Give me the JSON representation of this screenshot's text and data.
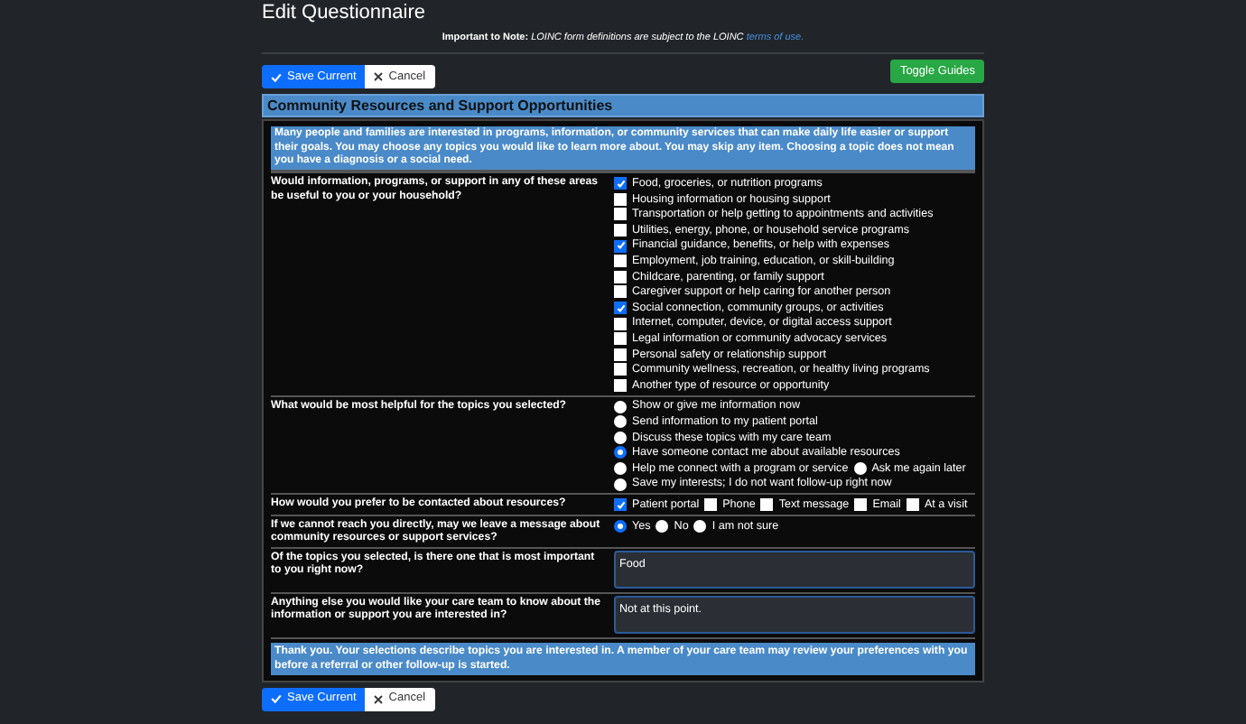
{
  "page_title": "Edit Questionnaire",
  "note": {
    "label": "Important to Note:",
    "text": "LOINC form definitions are subject to the LOINC",
    "link": "terms of use."
  },
  "top_buttons": [
    {
      "kind": "save",
      "label": "Save Current"
    },
    {
      "kind": "cancel",
      "label": "Cancel"
    }
  ],
  "toggle_button": "Toggle Guides",
  "section": {
    "title": "Community Resources and Support Opportunities",
    "intro": "Many people and families are interested in programs, information, or community services that can make daily life easier or support their goals. You may choose any topics you would like to learn more about. You may skip any item. Choosing a topic does not mean you have a diagnosis or a social need.",
    "questions": [
      {
        "kind": "checkbox",
        "question": "Would information, programs, or support in any of these areas be useful to you or your household?",
        "lines": [
          [
            {
              "label": "Food, groceries, or nutrition programs",
              "checked": true
            }
          ],
          [
            {
              "label": "Housing information or housing support",
              "checked": false
            }
          ],
          [
            {
              "label": "Transportation or help getting to appointments and activities",
              "checked": false
            }
          ],
          [
            {
              "label": "Utilities, energy, phone, or household service programs",
              "checked": false
            }
          ],
          [
            {
              "label": "Financial guidance, benefits, or help with expenses",
              "checked": true
            }
          ],
          [
            {
              "label": "Employment, job training, education, or skill-building",
              "checked": false
            }
          ],
          [
            {
              "label": "Childcare, parenting, or family support",
              "checked": false
            }
          ],
          [
            {
              "label": "Caregiver support or help caring for another person",
              "checked": false
            }
          ],
          [
            {
              "label": "Social connection, community groups, or activities",
              "checked": true
            }
          ],
          [
            {
              "label": "Internet, computer, device, or digital access support",
              "checked": false
            }
          ],
          [
            {
              "label": "Legal information or community advocacy services",
              "checked": false
            }
          ],
          [
            {
              "label": "Personal safety or relationship support",
              "checked": false
            }
          ],
          [
            {
              "label": "Community wellness, recreation, or healthy living programs",
              "checked": false
            }
          ],
          [
            {
              "label": "Another type of resource or opportunity",
              "checked": false
            }
          ]
        ]
      },
      {
        "kind": "radio",
        "question": "What would be most helpful for the topics you selected?",
        "lines": [
          [
            {
              "label": "Show or give me information now",
              "selected": false
            }
          ],
          [
            {
              "label": "Send information to my patient portal",
              "selected": false
            }
          ],
          [
            {
              "label": "Discuss these topics with my care team",
              "selected": false
            }
          ],
          [
            {
              "label": "Have someone contact me about available resources",
              "selected": true
            }
          ],
          [
            {
              "label": "Help me connect with a program or service",
              "selected": false
            },
            {
              "label": "Ask me again later",
              "selected": false
            }
          ],
          [
            {
              "label": "Save my interests; I do not want follow-up right now",
              "selected": false
            }
          ]
        ]
      },
      {
        "kind": "checkbox",
        "question": "How would you prefer to be contacted about resources?",
        "lines": [
          [
            {
              "label": "Patient portal",
              "checked": true
            },
            {
              "label": "Phone",
              "checked": false
            },
            {
              "label": "Text message",
              "checked": false
            },
            {
              "label": "Email",
              "checked": false
            },
            {
              "label": "At a visit",
              "checked": false
            }
          ]
        ]
      },
      {
        "kind": "radio",
        "question": "If we cannot reach you directly, may we leave a message about community resources or support services?",
        "lines": [
          [
            {
              "label": "Yes",
              "selected": true
            },
            {
              "label": "No",
              "selected": false
            },
            {
              "label": "I am not sure",
              "selected": false
            }
          ]
        ]
      },
      {
        "kind": "text",
        "question": "Of the topics you selected, is there one that is most important to you right now?",
        "value": "Food"
      },
      {
        "kind": "text",
        "question": "Anything else you would like your care team to know about the information or support you are interested in?",
        "value": "Not at this point."
      }
    ],
    "closing": "Thank you. Your selections describe topics you are interested in. A member of your care team may review your preferences with you before a referral or other follow-up is started."
  },
  "bottom_buttons": [
    {
      "kind": "save",
      "label": "Save Current"
    },
    {
      "kind": "cancel",
      "label": "Cancel"
    }
  ]
}
